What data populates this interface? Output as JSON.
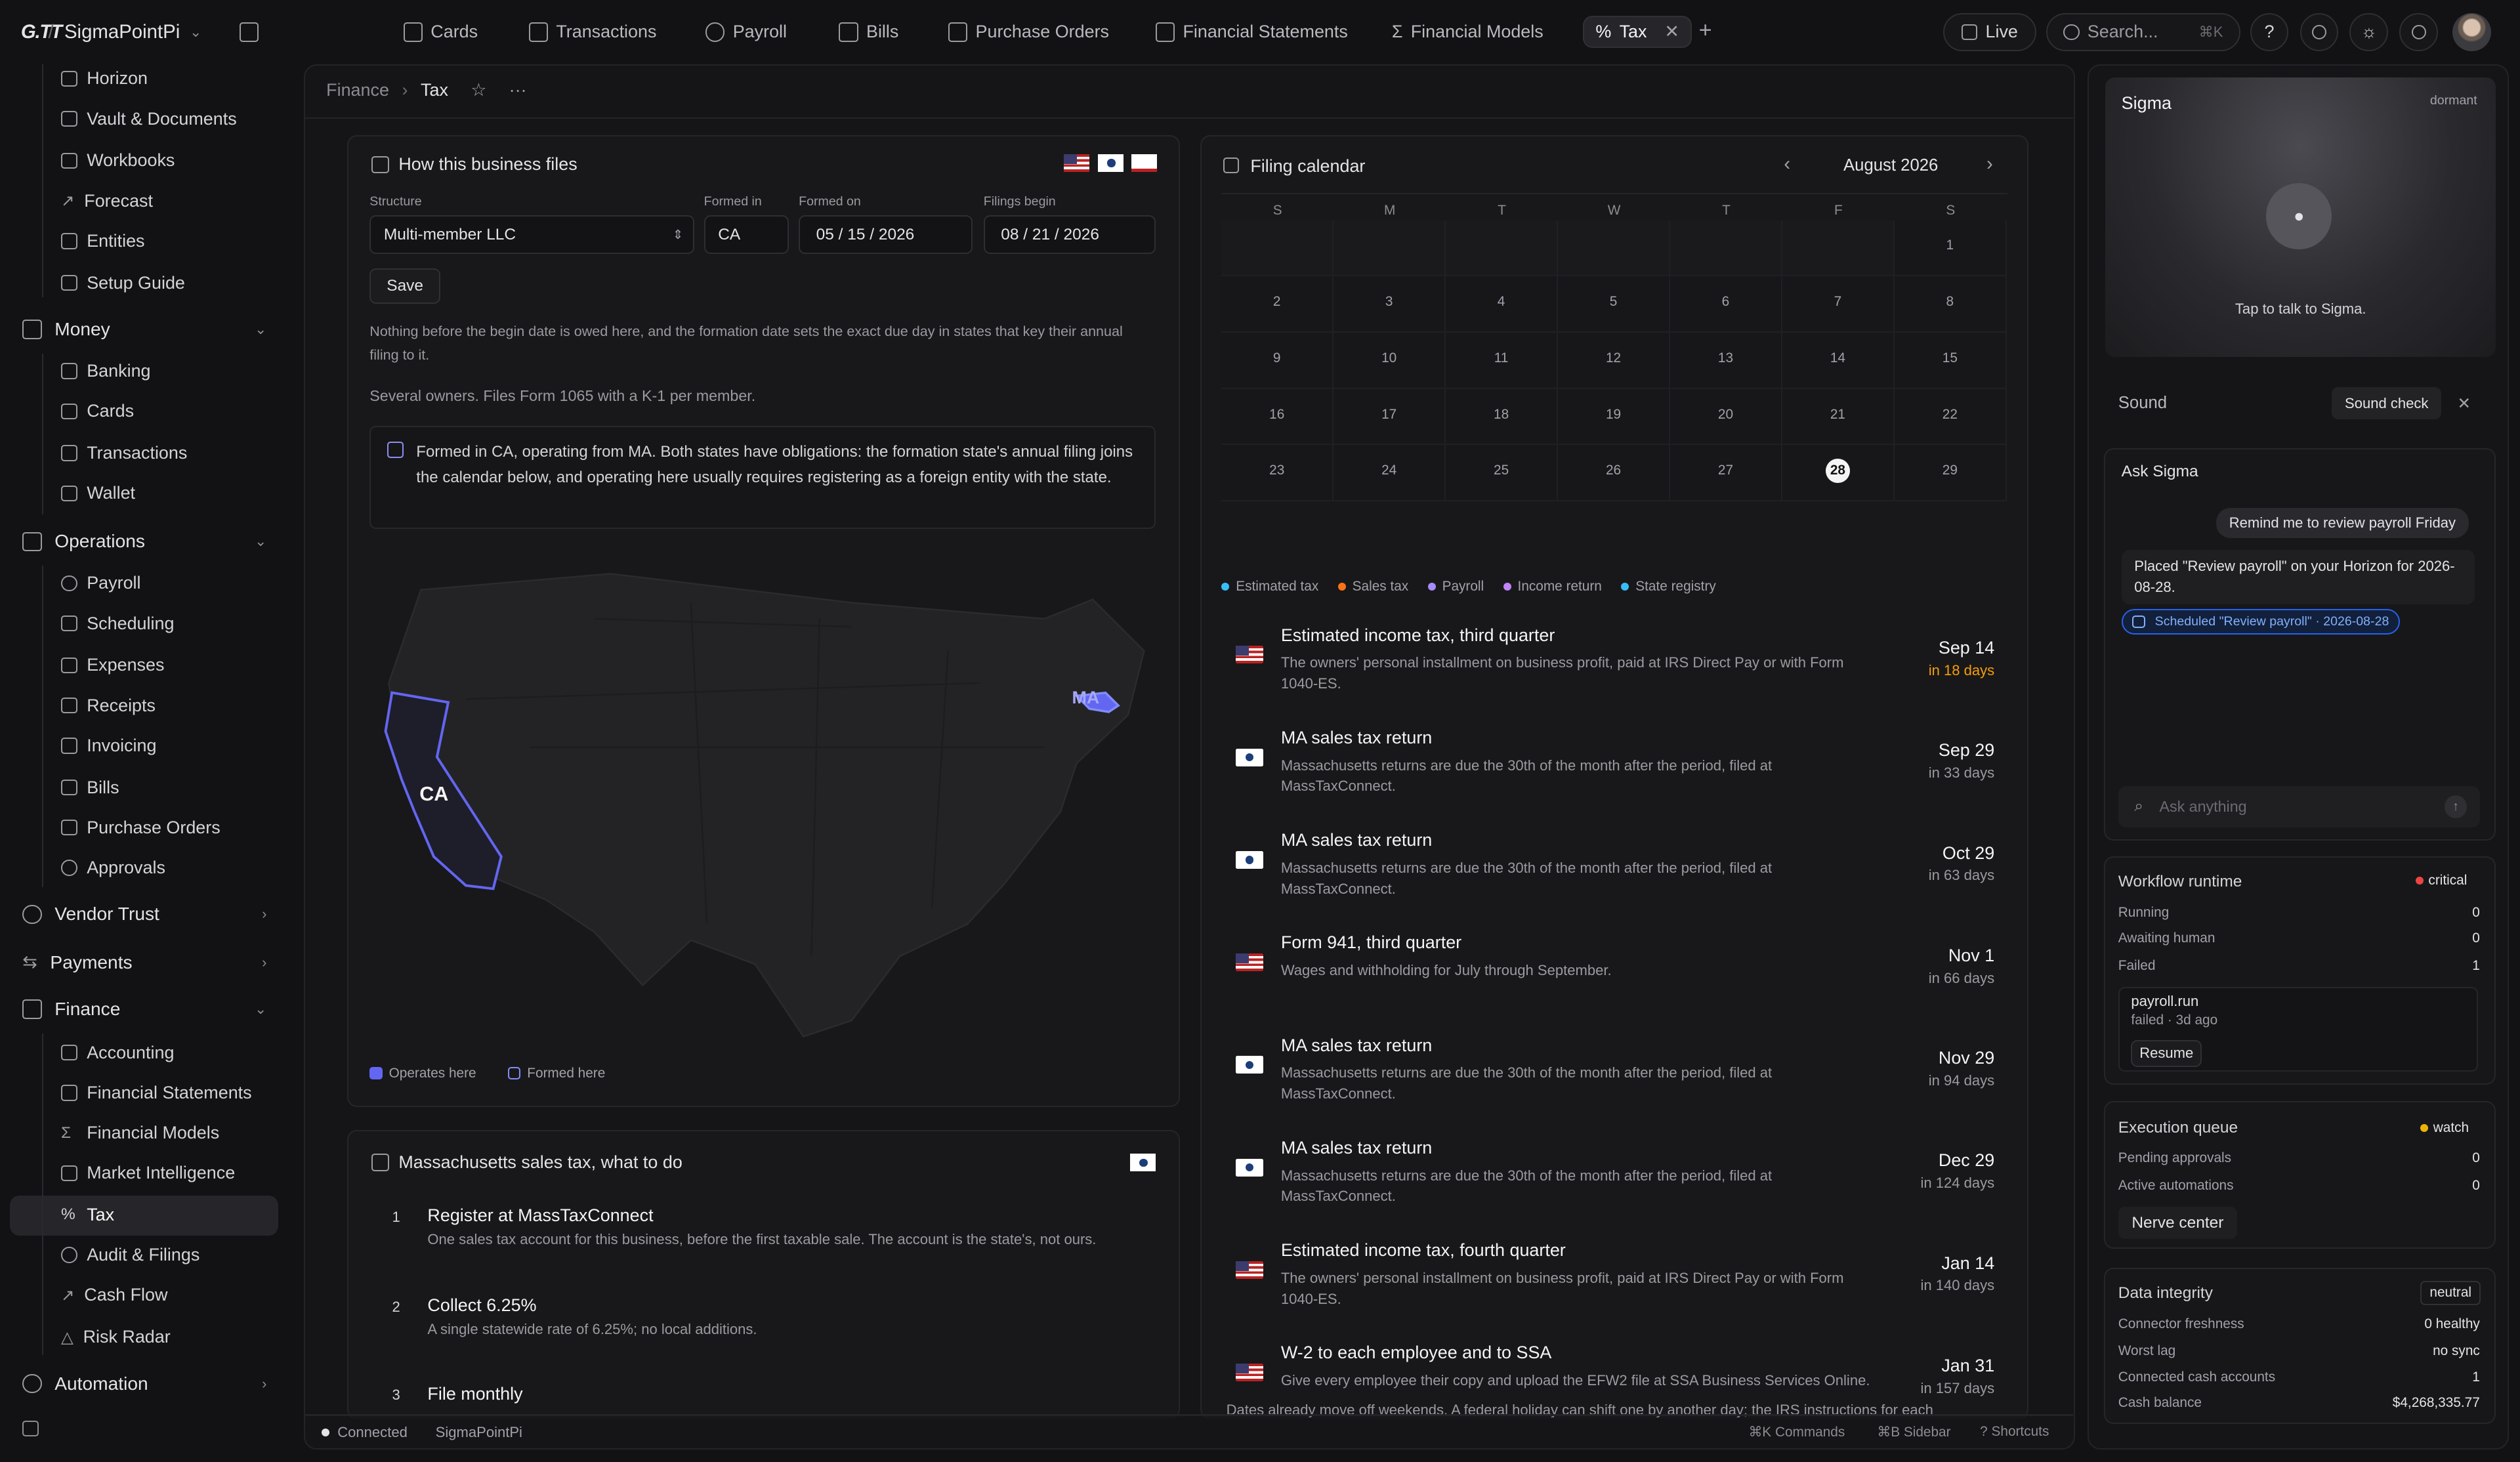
{
  "app": {
    "logo": "G.TT",
    "org": "SigmaPointPi"
  },
  "tabs": [
    {
      "label": "Cards"
    },
    {
      "label": "Transactions"
    },
    {
      "label": "Payroll"
    },
    {
      "label": "Bills"
    },
    {
      "label": "Purchase Orders"
    },
    {
      "label": "Financial Statements"
    },
    {
      "label": "Financial Models"
    },
    {
      "label": "Tax"
    }
  ],
  "topbar": {
    "live": "Live",
    "search": "Search...",
    "search_kbd": "⌘K"
  },
  "sidebar": {
    "top_items": [
      "Horizon",
      "Vault & Documents",
      "Workbooks",
      "Forecast",
      "Entities",
      "Setup Guide"
    ],
    "money": {
      "label": "Money",
      "items": [
        "Banking",
        "Cards",
        "Transactions",
        "Wallet"
      ]
    },
    "operations": {
      "label": "Operations",
      "items": [
        "Payroll",
        "Scheduling",
        "Expenses",
        "Receipts",
        "Invoicing",
        "Bills",
        "Purchase Orders",
        "Approvals"
      ]
    },
    "vendor_trust": "Vendor Trust",
    "payments": "Payments",
    "finance": {
      "label": "Finance",
      "items": [
        "Accounting",
        "Financial Statements",
        "Financial Models",
        "Market Intelligence",
        "Tax",
        "Audit & Filings",
        "Cash Flow",
        "Risk Radar"
      ]
    },
    "automation": "Automation"
  },
  "breadcrumb": {
    "parent": "Finance",
    "current": "Tax"
  },
  "files": {
    "title": "How this business files",
    "structure_label": "Structure",
    "structure_value": "Multi-member LLC",
    "formed_in_label": "Formed in",
    "formed_in_value": "CA",
    "formed_on_label": "Formed on",
    "formed_on_value": "05 / 15 / 2026",
    "filings_label": "Filings begin",
    "filings_value": "08 / 21 / 2026",
    "save": "Save",
    "note1": "Nothing before the begin date is owed here, and the formation date sets the exact due day in states that key their annual filing to it.",
    "note2": "Several owners. Files Form 1065 with a K-1 per member.",
    "callout": "Formed in CA, operating from MA. Both states have obligations: the formation state's annual filing joins the calendar below, and operating here usually requires registering as a foreign entity with the state.",
    "map_ca": "CA",
    "map_ma": "MA",
    "legend_operates": "Operates here",
    "legend_formed": "Formed here",
    "colors": {
      "operates": "#6366f1",
      "formed": "#818cf8"
    }
  },
  "ma_tax": {
    "title": "Massachusetts sales tax, what to do",
    "steps": [
      {
        "n": "1",
        "title": "Register at MassTaxConnect",
        "desc": "One sales tax account for this business, before the first taxable sale. The account is the state's, not ours."
      },
      {
        "n": "2",
        "title": "Collect 6.25%",
        "desc": "A single statewide rate of 6.25%; no local additions."
      },
      {
        "n": "3",
        "title": "File monthly",
        "desc": ""
      }
    ]
  },
  "calendar": {
    "title": "Filing calendar",
    "month": "August 2026",
    "weekdays": [
      "S",
      "M",
      "T",
      "W",
      "T",
      "F",
      "S"
    ],
    "today": "28",
    "legend": [
      {
        "label": "Estimated tax",
        "color": "#38bdf8"
      },
      {
        "label": "Sales tax",
        "color": "#f97316"
      },
      {
        "label": "Payroll",
        "color": "#a78bfa"
      },
      {
        "label": "Income return",
        "color": "#c084fc"
      },
      {
        "label": "State registry",
        "color": "#38bdf8"
      }
    ],
    "events": [
      {
        "flag": "us",
        "title": "Estimated income tax, third quarter",
        "desc": "The owners' personal installment on business profit, paid at IRS Direct Pay or with Form 1040-ES.",
        "date": "Sep 14",
        "in": "in 18 days",
        "urgent": true
      },
      {
        "flag": "ma",
        "title": "MA sales tax return",
        "desc": "Massachusetts returns are due the 30th of the month after the period, filed at MassTaxConnect.",
        "date": "Sep 29",
        "in": "in 33 days"
      },
      {
        "flag": "ma",
        "title": "MA sales tax return",
        "desc": "Massachusetts returns are due the 30th of the month after the period, filed at MassTaxConnect.",
        "date": "Oct 29",
        "in": "in 63 days"
      },
      {
        "flag": "us",
        "title": "Form 941, third quarter",
        "desc": "Wages and withholding for July through September.",
        "date": "Nov 1",
        "in": "in 66 days"
      },
      {
        "flag": "ma",
        "title": "MA sales tax return",
        "desc": "Massachusetts returns are due the 30th of the month after the period, filed at MassTaxConnect.",
        "date": "Nov 29",
        "in": "in 94 days"
      },
      {
        "flag": "ma",
        "title": "MA sales tax return",
        "desc": "Massachusetts returns are due the 30th of the month after the period, filed at MassTaxConnect.",
        "date": "Dec 29",
        "in": "in 124 days"
      },
      {
        "flag": "us",
        "title": "Estimated income tax, fourth quarter",
        "desc": "The owners' personal installment on business profit, paid at IRS Direct Pay or with Form 1040-ES.",
        "date": "Jan 14",
        "in": "in 140 days"
      },
      {
        "flag": "us",
        "title": "W-2 to each employee and to SSA",
        "desc": "Give every employee their copy and upload the EFW2 file at SSA Business Services Online.",
        "date": "Jan 31",
        "in": "in 157 days"
      }
    ],
    "footnote": "Dates already move off weekends. A federal holiday can shift one by another day; the IRS instructions for each"
  },
  "statusbar": {
    "connected": "Connected",
    "org": "SigmaPointPi",
    "commands": "⌘K Commands",
    "sidebar": "⌘B Sidebar",
    "shortcuts": "? Shortcuts"
  },
  "sigma": {
    "title": "Sigma",
    "state": "dormant",
    "tap": "Tap to talk to Sigma.",
    "sound": "Sound",
    "sound_check": "Sound check"
  },
  "ask": {
    "title": "Ask Sigma",
    "user_msg": "Remind me to review payroll Friday",
    "reply": "Placed \"Review payroll\" on your Horizon for 2026-08-28.",
    "chip": "Scheduled \"Review payroll\" · 2026-08-28",
    "placeholder": "Ask anything"
  },
  "workflow": {
    "title": "Workflow runtime",
    "badge": "critical",
    "running_label": "Running",
    "running": "0",
    "awaiting_label": "Awaiting human",
    "awaiting": "0",
    "failed_label": "Failed",
    "failed": "1",
    "job": "payroll.run",
    "job_status": "failed · 3d ago",
    "resume": "Resume"
  },
  "queue": {
    "title": "Execution queue",
    "badge": "watch",
    "pending_label": "Pending approvals",
    "pending": "0",
    "active_label": "Active automations",
    "active": "0",
    "nerve": "Nerve center"
  },
  "integrity": {
    "title": "Data integrity",
    "badge": "neutral",
    "fresh_label": "Connector freshness",
    "fresh": "0 healthy",
    "lag_label": "Worst lag",
    "lag": "no sync",
    "cash_label": "Connected cash accounts",
    "cash": "1",
    "bal_label": "Cash balance",
    "bal": "$4,268,335.77"
  }
}
